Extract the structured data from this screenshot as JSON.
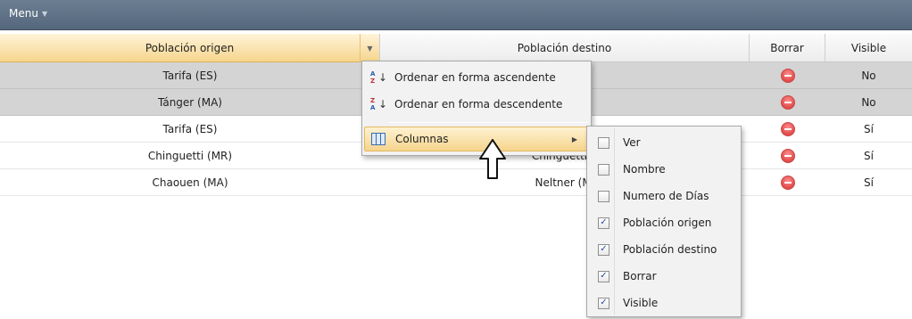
{
  "menubar": {
    "label": "Menu"
  },
  "grid": {
    "headers": {
      "origin": "Población origen",
      "destination": "Población destino",
      "delete": "Borrar",
      "visible": "Visible"
    },
    "rows": [
      {
        "origin": "Tarifa (ES)",
        "destination": "",
        "visible": "No",
        "selected": true
      },
      {
        "origin": "Tánger (MA)",
        "destination": "",
        "visible": "No",
        "selected": true
      },
      {
        "origin": "Tarifa (ES)",
        "destination": "",
        "visible": "Sí",
        "selected": false
      },
      {
        "origin": "Chinguetti (MR)",
        "destination": "Chinguetti (I",
        "visible": "Sí",
        "selected": false
      },
      {
        "origin": "Chaouen (MA)",
        "destination": "Neltner (M.",
        "visible": "Sí",
        "selected": false
      }
    ]
  },
  "context_menu": {
    "sort_asc": "Ordenar en forma ascendente",
    "sort_desc": "Ordenar en forma descendente",
    "columns": "Columnas",
    "sort_asc_glyph": {
      "top": "A",
      "bottom": "Z"
    },
    "sort_desc_glyph": {
      "top": "Z",
      "bottom": "A"
    }
  },
  "columns_submenu": [
    {
      "label": "Ver",
      "checked": false
    },
    {
      "label": "Nombre",
      "checked": false
    },
    {
      "label": "Numero de Días",
      "checked": false
    },
    {
      "label": "Población origen",
      "checked": true
    },
    {
      "label": "Población destino",
      "checked": true
    },
    {
      "label": "Borrar",
      "checked": true
    },
    {
      "label": "Visible",
      "checked": true
    }
  ],
  "colors": {
    "menubar": "#5f7187",
    "header_active": "#f6d58c",
    "row_selected": "#d4d4d4",
    "delete_icon": "#e14a4a"
  }
}
